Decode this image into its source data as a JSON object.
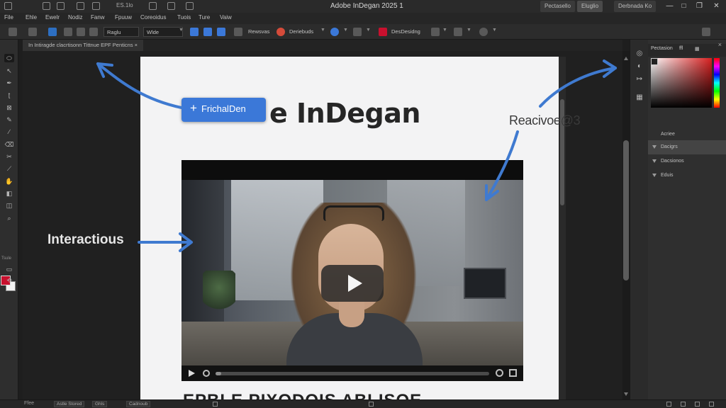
{
  "app": {
    "title": "Adobe InDegan 2025 1",
    "home_label": "ES.1lo"
  },
  "workspace_tabs": [
    "Pectasello",
    "Eluglio",
    "Derbnada Ko"
  ],
  "menu": [
    "File",
    "Ehle",
    "Ewelr",
    "Nodiz",
    "Fanw",
    "Fpuuw",
    "Coreoidus",
    "Tuois",
    "Ture",
    "Vaiw"
  ],
  "control_bar": {
    "field_font": "Raglu",
    "field_style": "Wlde",
    "field_reactive": "Rewsvas",
    "field_doc": "Deriebuds",
    "field_design": "DesDesidng"
  },
  "document_tab": "In Intiragde clacrtisonn Tittnue EPF Penticns",
  "tools": {
    "label_fill": "Tsule",
    "label_mode": "Ysicr"
  },
  "canvas": {
    "heading": "e InDegan",
    "callout_button": "FrichalDen",
    "label_left": "Interactious",
    "label_right": "Reacivoe@3",
    "footer_text": "EPBLE PIXODOIS ABLISOE",
    "video_progress": 0.02
  },
  "panel": {
    "tabs": [
      "Pectasion",
      "ffl"
    ],
    "layers": [
      "Acriee",
      "Dacigrs",
      "Dacsionos",
      "Eduis"
    ],
    "active_layer": 1
  },
  "status": {
    "page": "Ffee",
    "zoom": "Astle Stored",
    "mode": "Ghls",
    "preflight": "Cadnoub"
  },
  "colors": {
    "accent": "#3b78d8",
    "fill_swatch": "#c8102e",
    "arrow": "#3f7ad0"
  }
}
